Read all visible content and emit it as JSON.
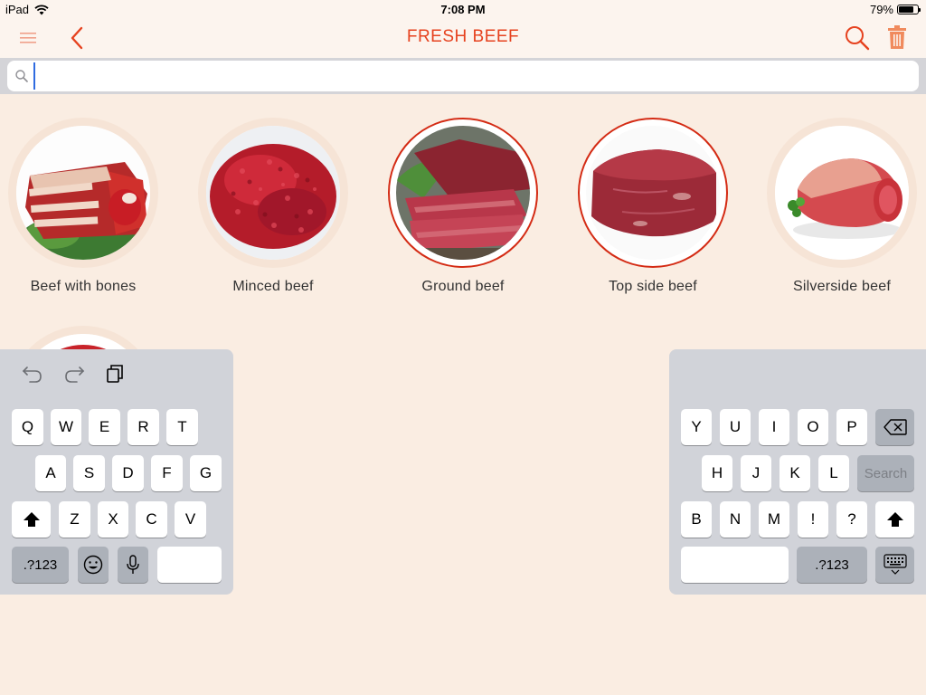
{
  "status": {
    "device": "iPad",
    "time": "7:08 PM",
    "battery": "79%",
    "battery_level": 0.79
  },
  "nav": {
    "title": "FRESH BEEF",
    "menu_icon": "menu-icon",
    "back_icon": "chevron-left-icon",
    "search_icon": "search-icon",
    "trash_icon": "trash-icon"
  },
  "search": {
    "value": "",
    "placeholder": ""
  },
  "items": [
    {
      "label": "Beef with bones",
      "selected": false
    },
    {
      "label": "Minced beef",
      "selected": false
    },
    {
      "label": "Ground beef",
      "selected": true
    },
    {
      "label": "Top side beef",
      "selected": true
    },
    {
      "label": "Silverside beef",
      "selected": false
    }
  ],
  "colors": {
    "accent": "#e6421f",
    "background": "#faede2",
    "selected_ring": "#d42b14"
  },
  "keyboard": {
    "left": {
      "row1": [
        "Q",
        "W",
        "E",
        "R",
        "T"
      ],
      "row2": [
        "A",
        "S",
        "D",
        "F",
        "G"
      ],
      "row3": [
        "Z",
        "X",
        "C",
        "V"
      ],
      "numbers_key": ".?123"
    },
    "right": {
      "row1": [
        "Y",
        "U",
        "I",
        "O",
        "P"
      ],
      "row2": [
        "H",
        "J",
        "K",
        "L"
      ],
      "row3": [
        "B",
        "N",
        "M",
        "!",
        "?"
      ],
      "search_key": "Search",
      "numbers_key": ".?123"
    }
  }
}
